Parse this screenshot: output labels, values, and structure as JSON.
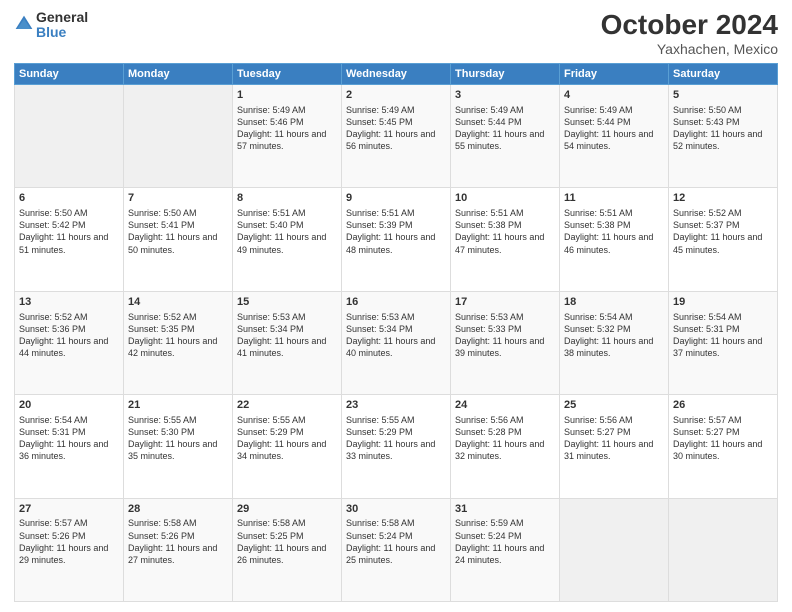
{
  "header": {
    "logo_general": "General",
    "logo_blue": "Blue",
    "month": "October 2024",
    "location": "Yaxhachen, Mexico"
  },
  "days_of_week": [
    "Sunday",
    "Monday",
    "Tuesday",
    "Wednesday",
    "Thursday",
    "Friday",
    "Saturday"
  ],
  "weeks": [
    [
      {
        "day": "",
        "empty": true
      },
      {
        "day": "",
        "empty": true
      },
      {
        "day": "1",
        "sunrise": "5:49 AM",
        "sunset": "5:46 PM",
        "daylight": "11 hours and 57 minutes."
      },
      {
        "day": "2",
        "sunrise": "5:49 AM",
        "sunset": "5:45 PM",
        "daylight": "11 hours and 56 minutes."
      },
      {
        "day": "3",
        "sunrise": "5:49 AM",
        "sunset": "5:44 PM",
        "daylight": "11 hours and 55 minutes."
      },
      {
        "day": "4",
        "sunrise": "5:49 AM",
        "sunset": "5:44 PM",
        "daylight": "11 hours and 54 minutes."
      },
      {
        "day": "5",
        "sunrise": "5:50 AM",
        "sunset": "5:43 PM",
        "daylight": "11 hours and 52 minutes."
      }
    ],
    [
      {
        "day": "6",
        "sunrise": "5:50 AM",
        "sunset": "5:42 PM",
        "daylight": "11 hours and 51 minutes."
      },
      {
        "day": "7",
        "sunrise": "5:50 AM",
        "sunset": "5:41 PM",
        "daylight": "11 hours and 50 minutes."
      },
      {
        "day": "8",
        "sunrise": "5:51 AM",
        "sunset": "5:40 PM",
        "daylight": "11 hours and 49 minutes."
      },
      {
        "day": "9",
        "sunrise": "5:51 AM",
        "sunset": "5:39 PM",
        "daylight": "11 hours and 48 minutes."
      },
      {
        "day": "10",
        "sunrise": "5:51 AM",
        "sunset": "5:38 PM",
        "daylight": "11 hours and 47 minutes."
      },
      {
        "day": "11",
        "sunrise": "5:51 AM",
        "sunset": "5:38 PM",
        "daylight": "11 hours and 46 minutes."
      },
      {
        "day": "12",
        "sunrise": "5:52 AM",
        "sunset": "5:37 PM",
        "daylight": "11 hours and 45 minutes."
      }
    ],
    [
      {
        "day": "13",
        "sunrise": "5:52 AM",
        "sunset": "5:36 PM",
        "daylight": "11 hours and 44 minutes."
      },
      {
        "day": "14",
        "sunrise": "5:52 AM",
        "sunset": "5:35 PM",
        "daylight": "11 hours and 42 minutes."
      },
      {
        "day": "15",
        "sunrise": "5:53 AM",
        "sunset": "5:34 PM",
        "daylight": "11 hours and 41 minutes."
      },
      {
        "day": "16",
        "sunrise": "5:53 AM",
        "sunset": "5:34 PM",
        "daylight": "11 hours and 40 minutes."
      },
      {
        "day": "17",
        "sunrise": "5:53 AM",
        "sunset": "5:33 PM",
        "daylight": "11 hours and 39 minutes."
      },
      {
        "day": "18",
        "sunrise": "5:54 AM",
        "sunset": "5:32 PM",
        "daylight": "11 hours and 38 minutes."
      },
      {
        "day": "19",
        "sunrise": "5:54 AM",
        "sunset": "5:31 PM",
        "daylight": "11 hours and 37 minutes."
      }
    ],
    [
      {
        "day": "20",
        "sunrise": "5:54 AM",
        "sunset": "5:31 PM",
        "daylight": "11 hours and 36 minutes."
      },
      {
        "day": "21",
        "sunrise": "5:55 AM",
        "sunset": "5:30 PM",
        "daylight": "11 hours and 35 minutes."
      },
      {
        "day": "22",
        "sunrise": "5:55 AM",
        "sunset": "5:29 PM",
        "daylight": "11 hours and 34 minutes."
      },
      {
        "day": "23",
        "sunrise": "5:55 AM",
        "sunset": "5:29 PM",
        "daylight": "11 hours and 33 minutes."
      },
      {
        "day": "24",
        "sunrise": "5:56 AM",
        "sunset": "5:28 PM",
        "daylight": "11 hours and 32 minutes."
      },
      {
        "day": "25",
        "sunrise": "5:56 AM",
        "sunset": "5:27 PM",
        "daylight": "11 hours and 31 minutes."
      },
      {
        "day": "26",
        "sunrise": "5:57 AM",
        "sunset": "5:27 PM",
        "daylight": "11 hours and 30 minutes."
      }
    ],
    [
      {
        "day": "27",
        "sunrise": "5:57 AM",
        "sunset": "5:26 PM",
        "daylight": "11 hours and 29 minutes."
      },
      {
        "day": "28",
        "sunrise": "5:58 AM",
        "sunset": "5:26 PM",
        "daylight": "11 hours and 27 minutes."
      },
      {
        "day": "29",
        "sunrise": "5:58 AM",
        "sunset": "5:25 PM",
        "daylight": "11 hours and 26 minutes."
      },
      {
        "day": "30",
        "sunrise": "5:58 AM",
        "sunset": "5:24 PM",
        "daylight": "11 hours and 25 minutes."
      },
      {
        "day": "31",
        "sunrise": "5:59 AM",
        "sunset": "5:24 PM",
        "daylight": "11 hours and 24 minutes."
      },
      {
        "day": "",
        "empty": true
      },
      {
        "day": "",
        "empty": true
      }
    ]
  ]
}
